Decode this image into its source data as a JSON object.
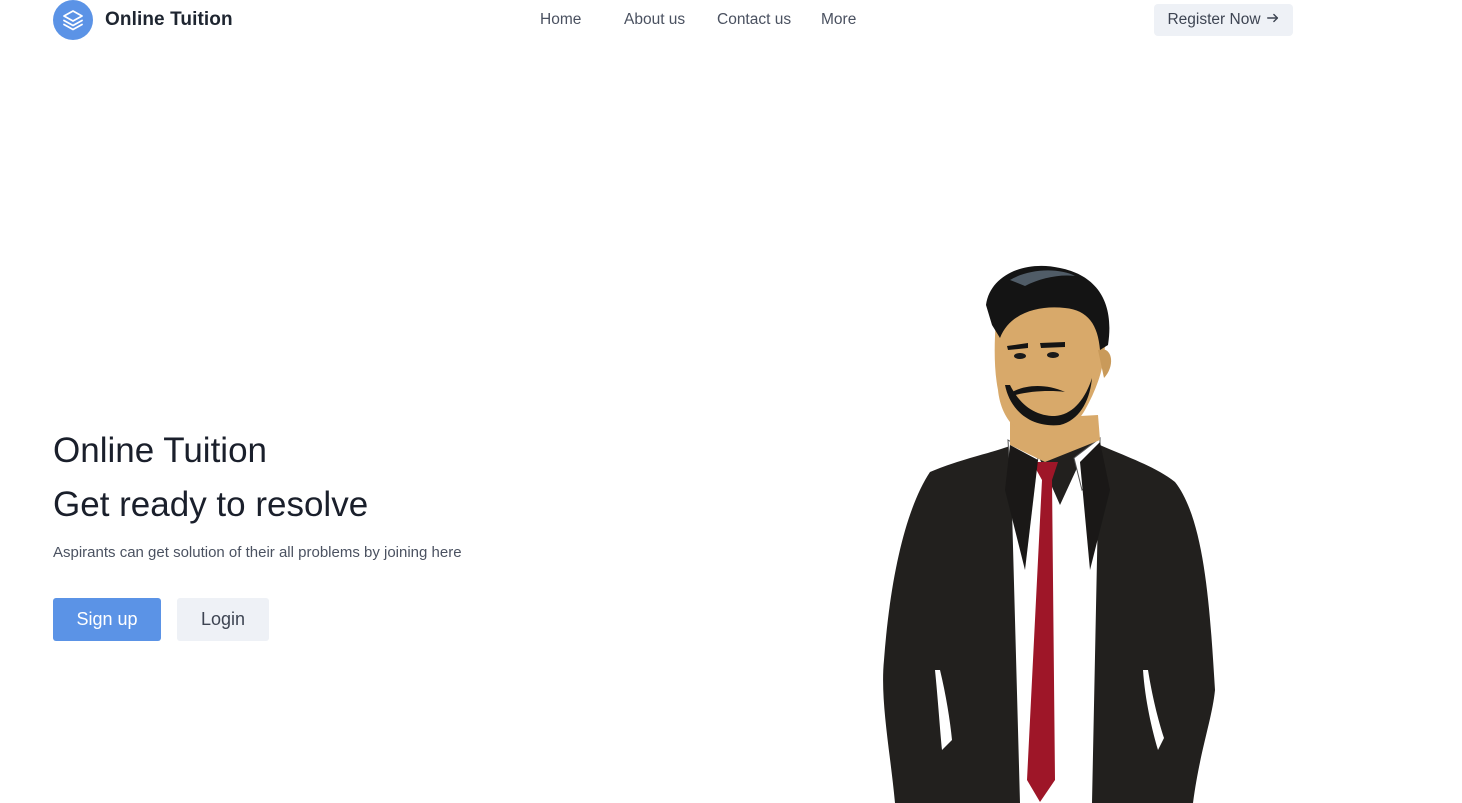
{
  "header": {
    "brand_name": "Online Tuition",
    "logo_icon": "layers-icon",
    "logo_color": "#5b93e6",
    "nav": {
      "home": "Home",
      "about": "About us",
      "contact": "Contact us",
      "more": "More"
    },
    "register_label": "Register Now",
    "register_icon": "arrow-right-icon"
  },
  "hero": {
    "title_line1": "Online Tuition",
    "title_line2": "Get ready to resolve",
    "subtitle": "Aspirants can get solution of their all problems by joining here",
    "signup_label": "Sign up",
    "login_label": "Login",
    "accent_color": "#5b93e6",
    "illustration": "businessman-illustration"
  }
}
